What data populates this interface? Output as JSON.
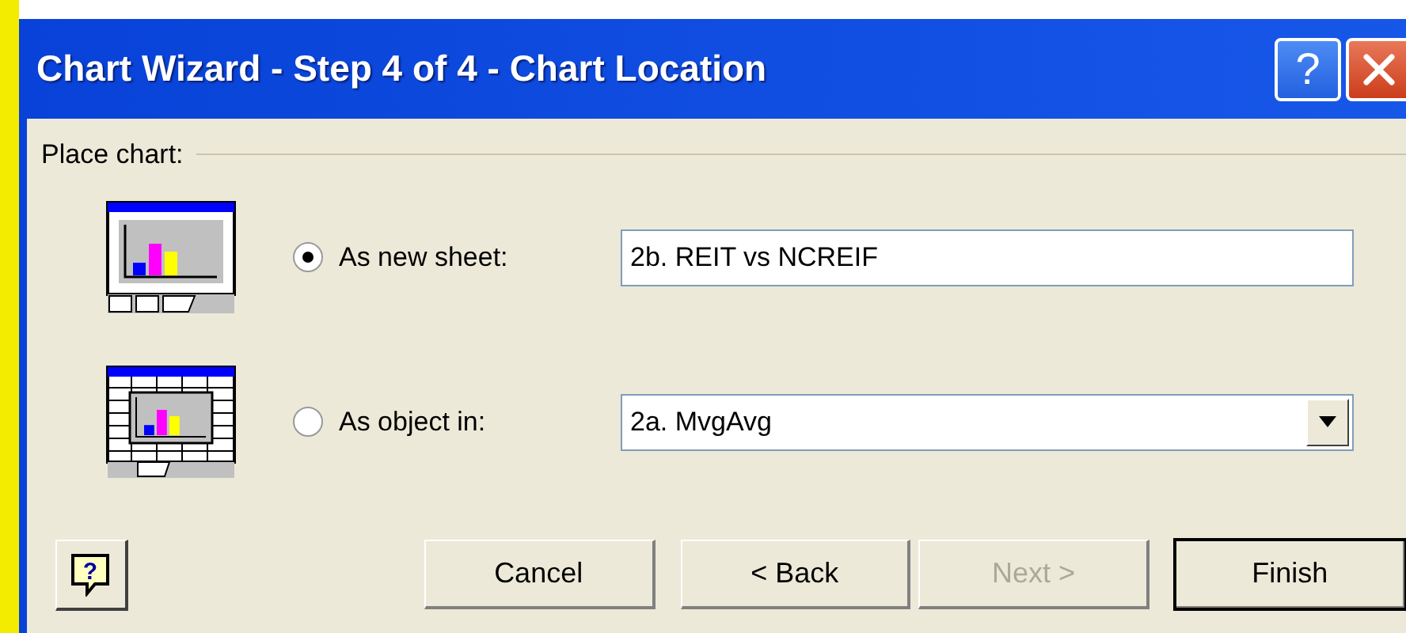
{
  "window": {
    "title": "Chart Wizard - Step 4 of 4 - Chart Location",
    "help_button": "?"
  },
  "place_chart": {
    "label": "Place chart:",
    "options": [
      {
        "kind": "sheet",
        "label": "As new sheet:",
        "selected": true,
        "value": "2b. REIT vs NCREIF"
      },
      {
        "kind": "object",
        "label": "As object in:",
        "selected": false,
        "value": "2a. MvgAvg"
      }
    ]
  },
  "footer_help": "?",
  "buttons": [
    {
      "label": "Cancel",
      "disabled": false,
      "default": false
    },
    {
      "label": "< Back",
      "disabled": false,
      "default": false
    },
    {
      "label": "Next >",
      "disabled": true,
      "default": false
    },
    {
      "label": "Finish",
      "disabled": false,
      "default": true
    }
  ]
}
